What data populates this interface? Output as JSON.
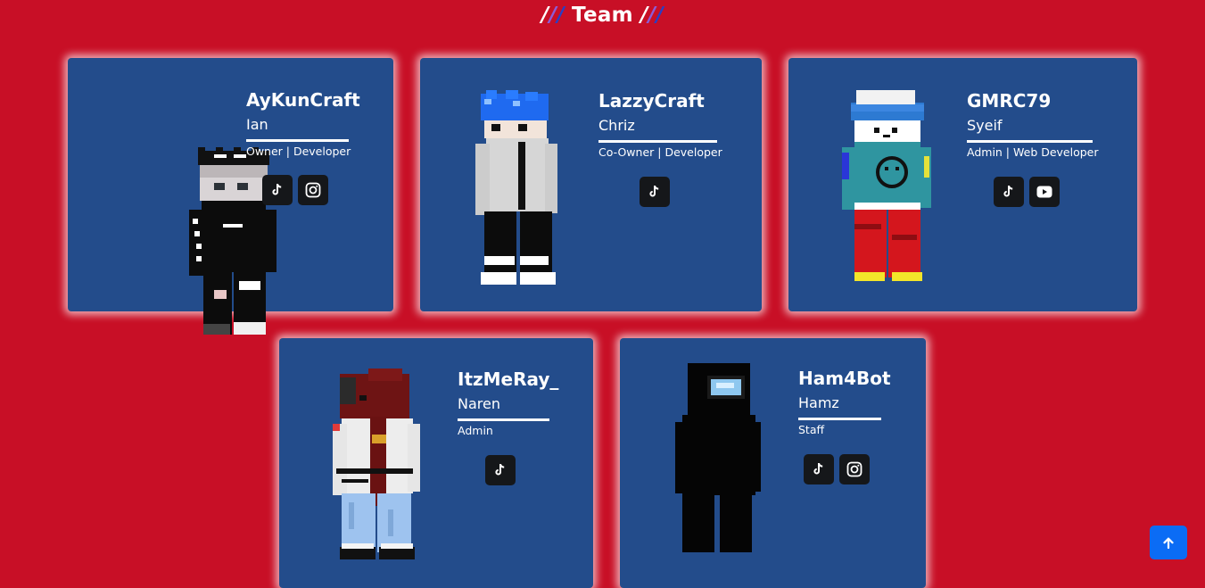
{
  "title": {
    "prefix": "///",
    "text": "Team",
    "suffix": "///"
  },
  "members": [
    {
      "username": "AyKunCraft",
      "name": "Ian",
      "role": "Owner | Developer",
      "socials": [
        "tiktok-icon",
        "instagram-icon"
      ]
    },
    {
      "username": "LazzyCraft",
      "name": "Chriz",
      "role": "Co-Owner | Developer",
      "socials": [
        "tiktok-icon"
      ]
    },
    {
      "username": "GMRC79",
      "name": "Syeif",
      "role": "Admin | Web Developer",
      "socials": [
        "tiktok-icon",
        "youtube-icon"
      ]
    },
    {
      "username": "ItzMeRay_",
      "name": "Naren",
      "role": "Admin",
      "socials": [
        "tiktok-icon"
      ]
    },
    {
      "username": "Ham4Bot",
      "name": "Hamz",
      "role": "Staff",
      "socials": [
        "tiktok-icon",
        "instagram-icon"
      ]
    }
  ],
  "colors": {
    "background": "#c80f26",
    "card": "#234c8b",
    "social_button": "#15171a",
    "back_to_top": "#0b6cf5"
  },
  "back_to_top_icon": "arrow-up-icon"
}
